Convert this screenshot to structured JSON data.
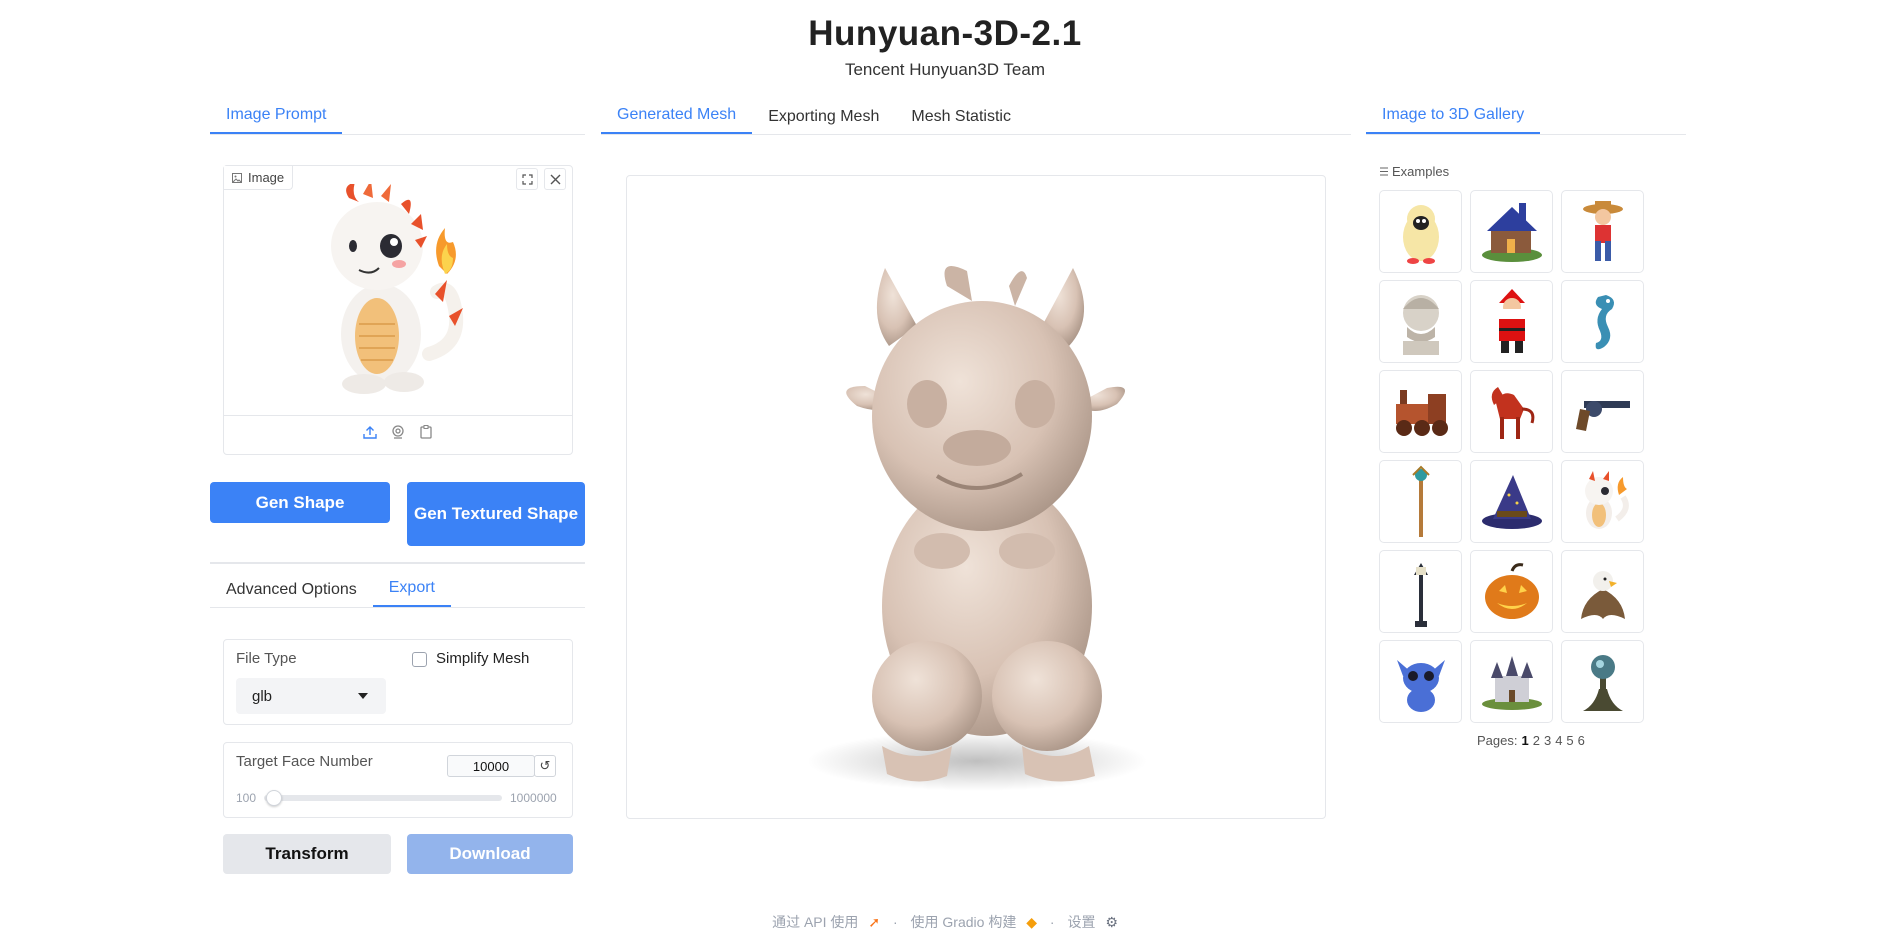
{
  "header": {
    "title": "Hunyuan-3D-2.1",
    "subtitle": "Tencent Hunyuan3D Team"
  },
  "left_tabs": [
    {
      "label": "Image Prompt",
      "active": true
    }
  ],
  "image_input": {
    "label": "Image",
    "fullscreen_icon": "fullscreen-icon",
    "close_icon": "close-icon",
    "tools": [
      "upload-icon",
      "webcam-icon",
      "clipboard-icon"
    ]
  },
  "actions": {
    "gen_shape": "Gen Shape",
    "gen_textured": "Gen Textured Shape"
  },
  "option_tabs": [
    {
      "label": "Advanced Options",
      "active": false
    },
    {
      "label": "Export",
      "active": true
    }
  ],
  "export": {
    "file_type_label": "File Type",
    "file_type_value": "glb",
    "simplify_label": "Simplify Mesh",
    "simplify_checked": false,
    "target_face_label": "Target Face Number",
    "target_face_value": "10000",
    "slider_min": "100",
    "slider_max": "1000000",
    "slider_fraction": 0.01,
    "transform": "Transform",
    "download": "Download"
  },
  "center_tabs": [
    {
      "label": "Generated Mesh",
      "active": true
    },
    {
      "label": "Exporting Mesh",
      "active": false
    },
    {
      "label": "Mesh Statistic",
      "active": false
    }
  ],
  "gallery_tabs": [
    {
      "label": "Image to 3D Gallery",
      "active": true
    }
  ],
  "gallery": {
    "label": "Examples",
    "items": [
      "penguin-costume",
      "blue-house",
      "pirate-boy",
      "stone-bust",
      "santa",
      "seahorse",
      "steam-engine",
      "red-horse",
      "revolver",
      "magic-staff",
      "wizard-hat",
      "baby-dragon",
      "street-lamp",
      "jack-o-lantern",
      "eagle",
      "stitch",
      "castle",
      "crystal-tree"
    ],
    "pages_label": "Pages:",
    "pages": [
      "1",
      "2",
      "3",
      "4",
      "5",
      "6"
    ],
    "current_page": "1"
  },
  "footer": {
    "api": "通过 API 使用",
    "gradio": "使用 Gradio 构建",
    "settings": "设置",
    "dot": "·"
  },
  "colors": {
    "accent": "#3b82f6",
    "disabled": "#93b4ec",
    "border": "#e5e7eb"
  }
}
